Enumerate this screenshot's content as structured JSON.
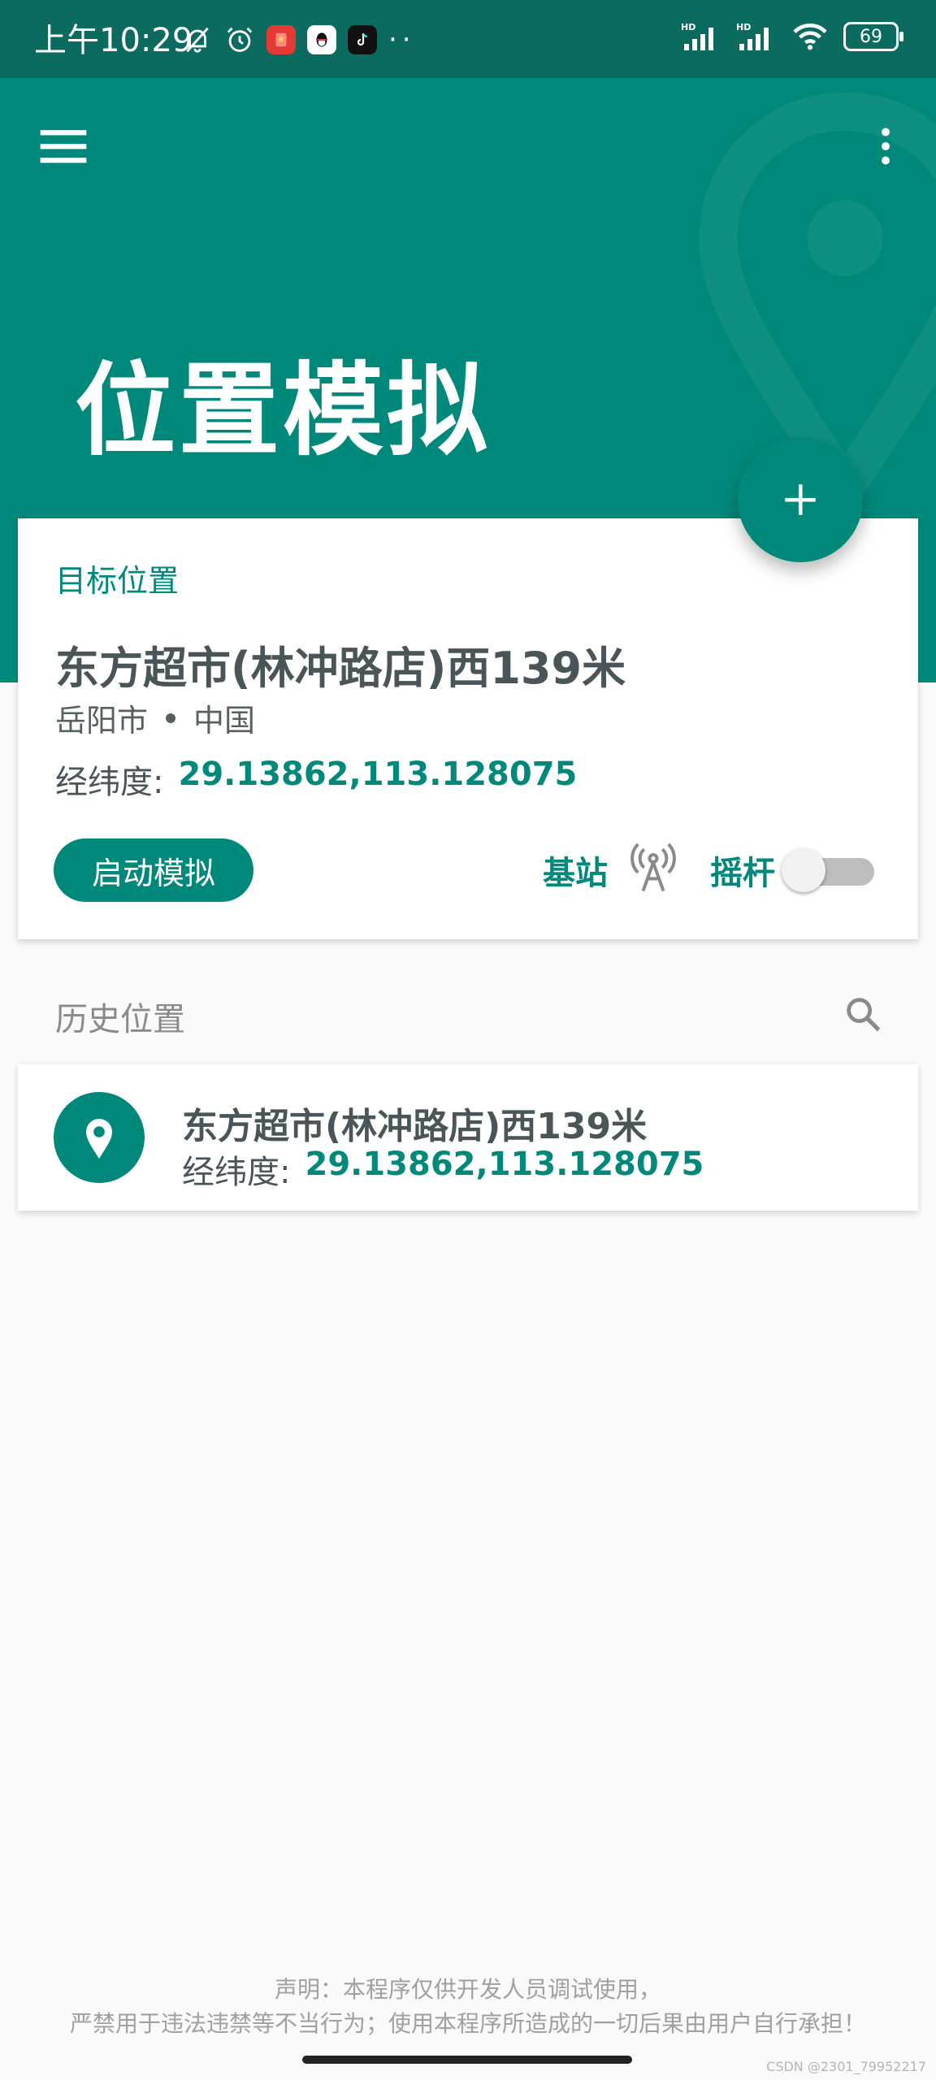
{
  "status_bar": {
    "time": "上午10:29",
    "battery": "69",
    "icons_left": [
      "bell-off-icon",
      "alarm-icon",
      "red-packet-icon",
      "qq-icon",
      "tiktok-icon"
    ],
    "icons_right": [
      "hd-signal-icon",
      "hd-signal-icon",
      "wifi-icon",
      "battery-icon"
    ],
    "dots": "··"
  },
  "header": {
    "title": "位置模拟",
    "bg_color": "#00897b"
  },
  "target_card": {
    "label": "目标位置",
    "place_name": "东方超市(林冲路店)西139米",
    "city": "岳阳市",
    "country": "中国",
    "coord_label": "经纬度:",
    "coord_value": "29.13862,113.128075",
    "start_button": "启动模拟",
    "base_station_label": "基站",
    "joystick_label": "摇杆",
    "joystick_on": false
  },
  "history": {
    "header": "历史位置",
    "items": [
      {
        "name": "东方超市(林冲路店)西139米",
        "coord_label": "经纬度:",
        "coord_value": "29.13862,113.128075"
      }
    ]
  },
  "disclaimer": {
    "line1": "声明：本程序仅供开发人员调试使用，",
    "line2": "严禁用于违法违禁等不当行为；使用本程序所造成的一切后果由用户自行承担！"
  },
  "watermark": "CSDN @2301_79952217",
  "colors": {
    "accent": "#00897b",
    "status_bar": "#0b6b5e",
    "text_dark": "#4a5559",
    "background": "#fafafa"
  }
}
